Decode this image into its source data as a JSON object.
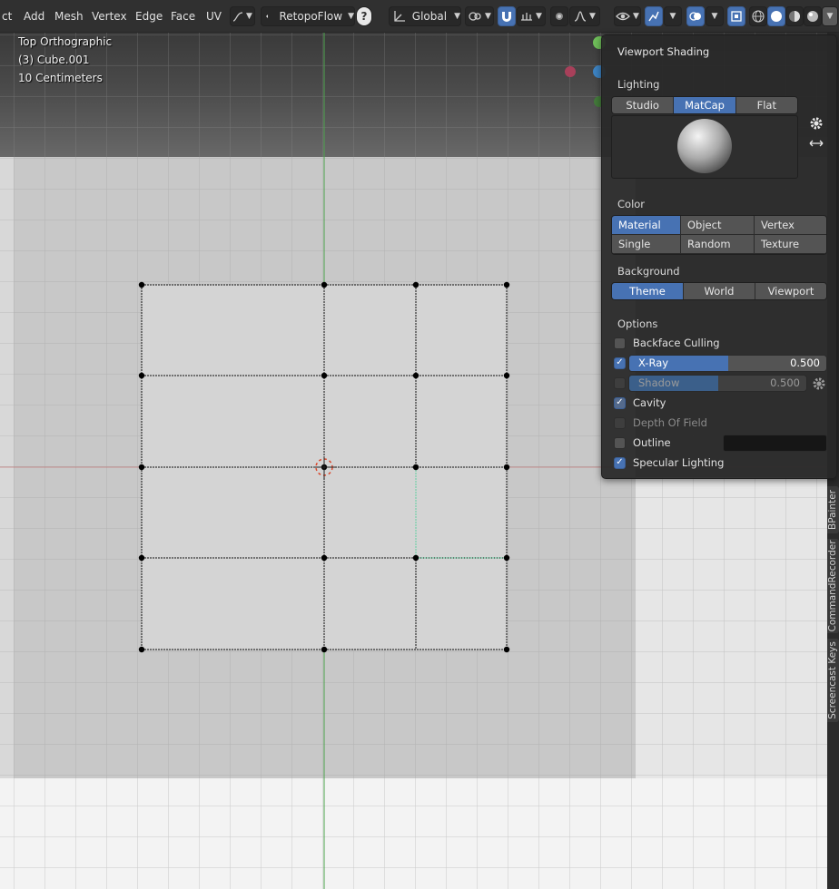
{
  "header": {
    "menus": [
      "ct",
      "Add",
      "Mesh",
      "Vertex",
      "Edge",
      "Face",
      "UV"
    ],
    "addon_label": "RetopoFlow",
    "help_icon": "?",
    "orientation": "Global"
  },
  "viewport": {
    "view_name": "Top Orthographic",
    "object_name": "(3) Cube.001",
    "scale": "10 Centimeters"
  },
  "sidebar_tabs": [
    "BPainter",
    "CommandRecorder",
    "Screencast Keys"
  ],
  "shading": {
    "title": "Viewport Shading",
    "lighting_label": "Lighting",
    "lighting_modes": [
      "Studio",
      "MatCap",
      "Flat"
    ],
    "lighting_selected": "MatCap",
    "color_label": "Color",
    "color_modes": [
      "Material",
      "Object",
      "Vertex",
      "Single",
      "Random",
      "Texture"
    ],
    "color_selected": "Material",
    "background_label": "Background",
    "background_modes": [
      "Theme",
      "World",
      "Viewport"
    ],
    "background_selected": "Theme",
    "options_label": "Options",
    "backface_culling": "Backface Culling",
    "xray_label": "X-Ray",
    "xray_value": "0.500",
    "xray_fraction": 0.5,
    "shadow_label": "Shadow",
    "shadow_value": "0.500",
    "shadow_fraction": 0.5,
    "cavity": "Cavity",
    "depth_of_field": "Depth Of Field",
    "outline": "Outline",
    "specular": "Specular Lighting"
  },
  "colors": {
    "accent": "#4772b3",
    "panel": "#282828",
    "vertex": "#000000",
    "axis_x": "#d55a5a",
    "axis_y": "#6fbf5a"
  }
}
